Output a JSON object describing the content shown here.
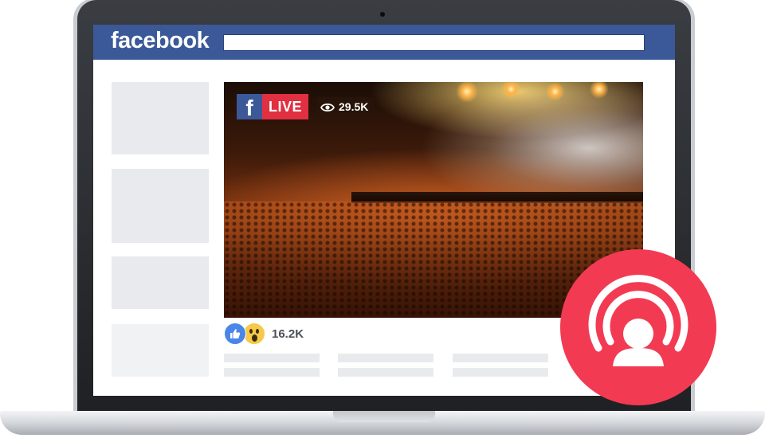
{
  "header": {
    "logo_text": "facebook",
    "brand_color": "#3b5998"
  },
  "video": {
    "brand_icon": "facebook-f-icon",
    "brand_icon_glyph": "f",
    "live_label": "LIVE",
    "live_color": "#e03041",
    "view_icon": "eye-icon",
    "view_count": "29.5K"
  },
  "reactions": {
    "icons": [
      "like-icon",
      "wow-icon"
    ],
    "count": "16.2K"
  },
  "live_badge": {
    "icon": "live-broadcast-person-icon",
    "color": "#f23b53"
  }
}
